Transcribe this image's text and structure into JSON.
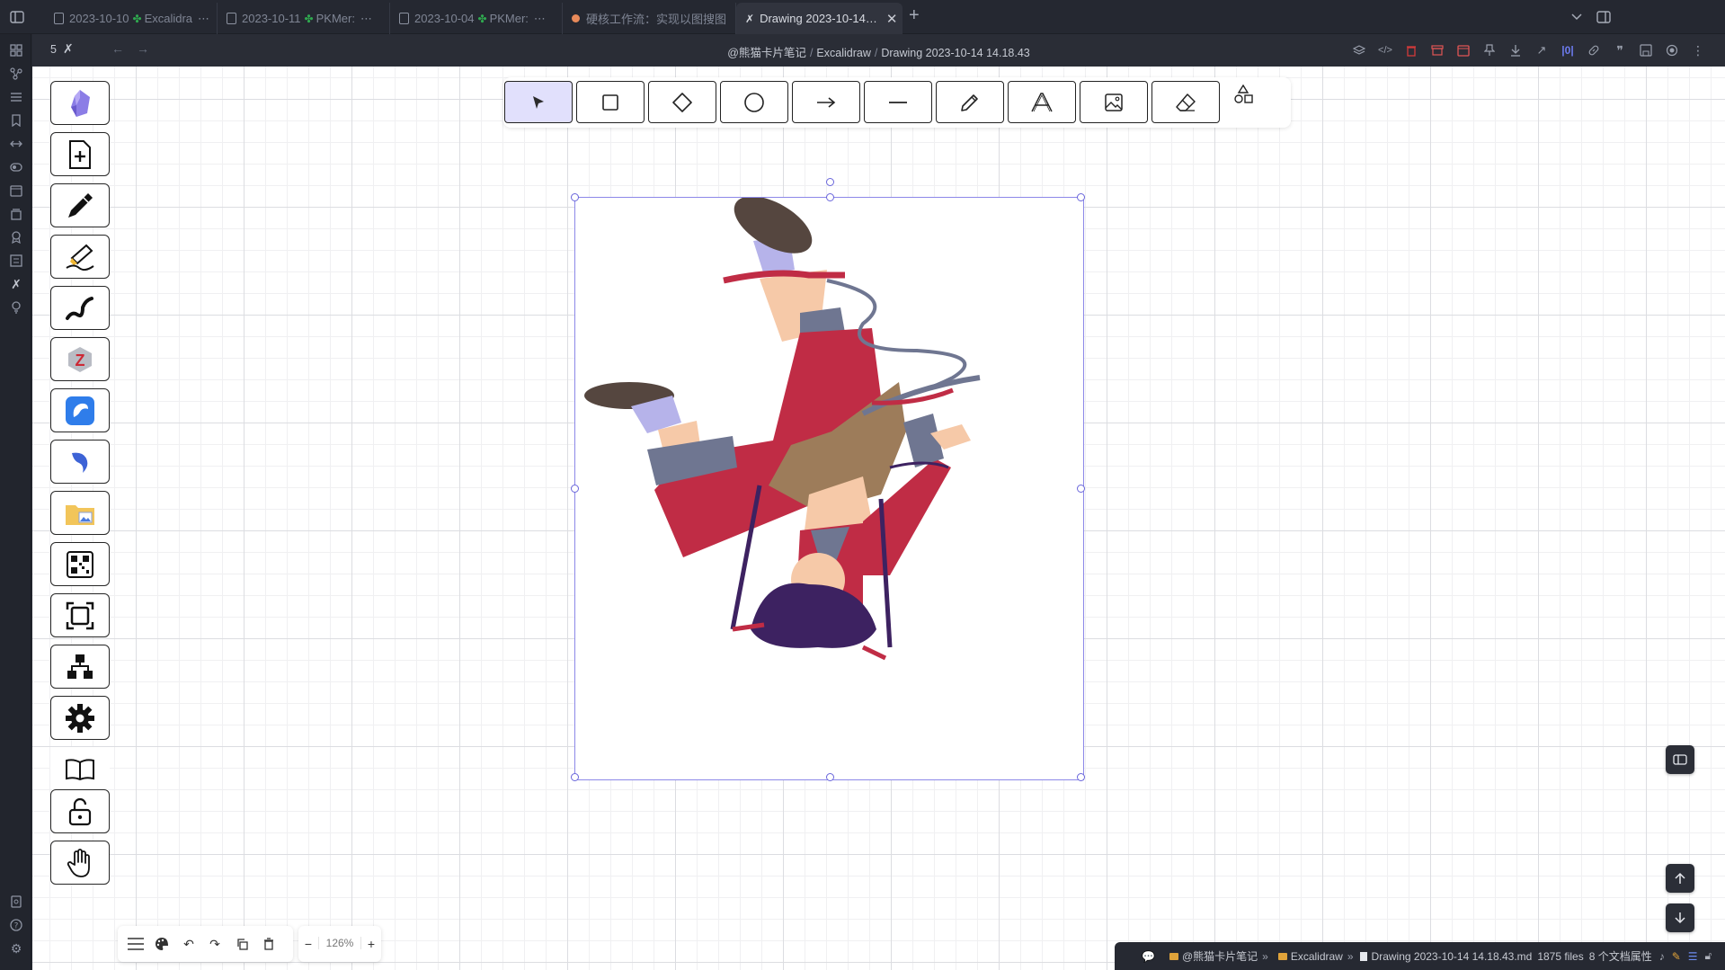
{
  "tabs": [
    {
      "date": "2023-10-10",
      "name": "Excalidra",
      "active": false
    },
    {
      "date": "2023-10-11",
      "name": "PKMer:",
      "active": false
    },
    {
      "date": "2023-10-04",
      "name": "PKMer:",
      "active": false
    },
    {
      "date": "",
      "name": "硬核工作流：实现以图搜图",
      "active": false
    },
    {
      "date": "",
      "name": "Drawing 2023-10-14…",
      "active": true
    }
  ],
  "header": {
    "count": "5",
    "breadcrumb": [
      "@熊猫卡片笔记",
      "Excalidraw",
      "Drawing 2023-10-14 14.18.43"
    ]
  },
  "left_tools": [
    "obsidian-icon",
    "new-file-icon",
    "pen-icon",
    "highlighter-icon",
    "squiggle-icon",
    "zotero-icon",
    "app-icon",
    "bird-icon",
    "folder-image-icon",
    "qr-icon",
    "frame-icon",
    "network-icon",
    "settings-icon",
    "book-icon",
    "unlock-icon",
    "hand-icon"
  ],
  "shape_tools": [
    "selection",
    "rectangle",
    "diamond",
    "ellipse",
    "arrow",
    "line",
    "draw",
    "text",
    "image",
    "eraser"
  ],
  "zoom": "126%",
  "status": {
    "vault": "@熊猫卡片笔记",
    "folder": "Excalidraw",
    "file": "Drawing 2023-10-14 14.18.43.md",
    "files": "1875 files",
    "props": "8 个文档属性"
  },
  "colors": {
    "accent": "#6965db",
    "tool_active_bg": "#e1e0fc",
    "jacket_red": "#c02c45",
    "hair_purple": "#3d2261"
  }
}
